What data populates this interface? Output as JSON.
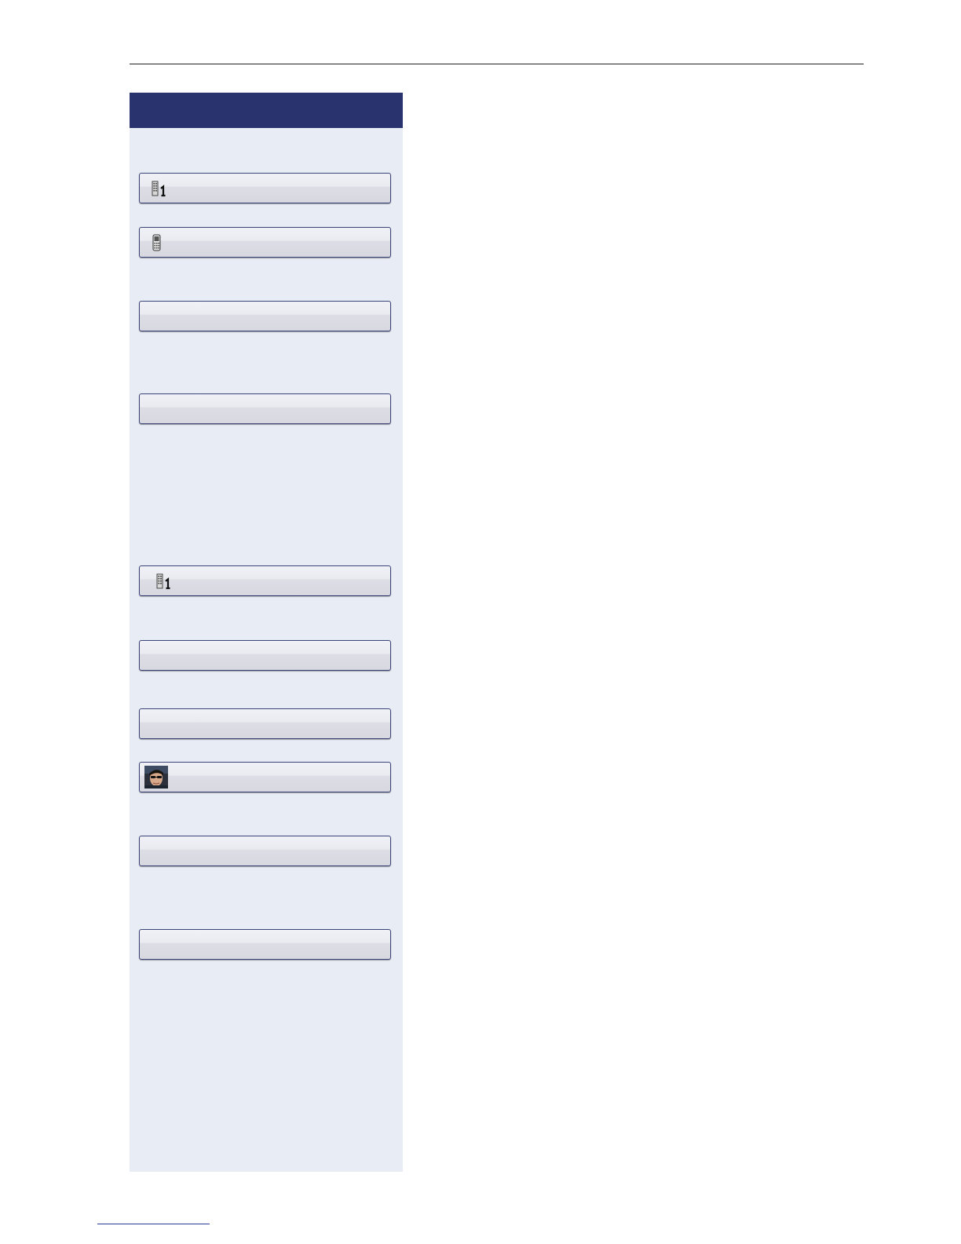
{
  "page": {
    "header_text": "",
    "footer_link_text": ""
  },
  "colors": {
    "panel_background": "#e8ecf4",
    "panel_header": "#29346e",
    "key_border": "#3a4377",
    "rule": "#222222",
    "footer_link": "#2a3c9a"
  },
  "keys": [
    {
      "label": "",
      "icon": "desk-phone-line-1-icon"
    },
    {
      "label": "",
      "icon": "mobile-phone-icon"
    },
    {
      "label": "",
      "icon": ""
    },
    {
      "label": "",
      "icon": ""
    },
    {
      "label": "",
      "icon": "desk-phone-line-1-icon"
    },
    {
      "label": "",
      "icon": ""
    },
    {
      "label": "",
      "icon": ""
    },
    {
      "label": "",
      "icon": "contact-photo-avatar"
    },
    {
      "label": "",
      "icon": ""
    },
    {
      "label": "",
      "icon": ""
    }
  ]
}
